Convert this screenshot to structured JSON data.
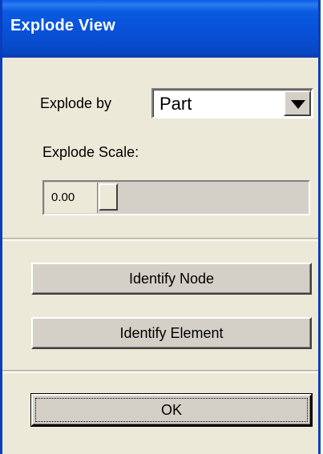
{
  "window": {
    "title": "Explode View"
  },
  "explode_by": {
    "label": "Explode by",
    "value": "Part"
  },
  "explode_scale": {
    "label": "Explode Scale:",
    "value": "0.00",
    "slider_fraction": 0.0
  },
  "buttons": {
    "identify_node": "Identify Node",
    "identify_element": "Identify Element",
    "ok": "OK"
  },
  "colors": {
    "titlebar": "#0a5ae0",
    "dialog_bg": "#ece9d8",
    "button_face": "#d4d0c8"
  }
}
